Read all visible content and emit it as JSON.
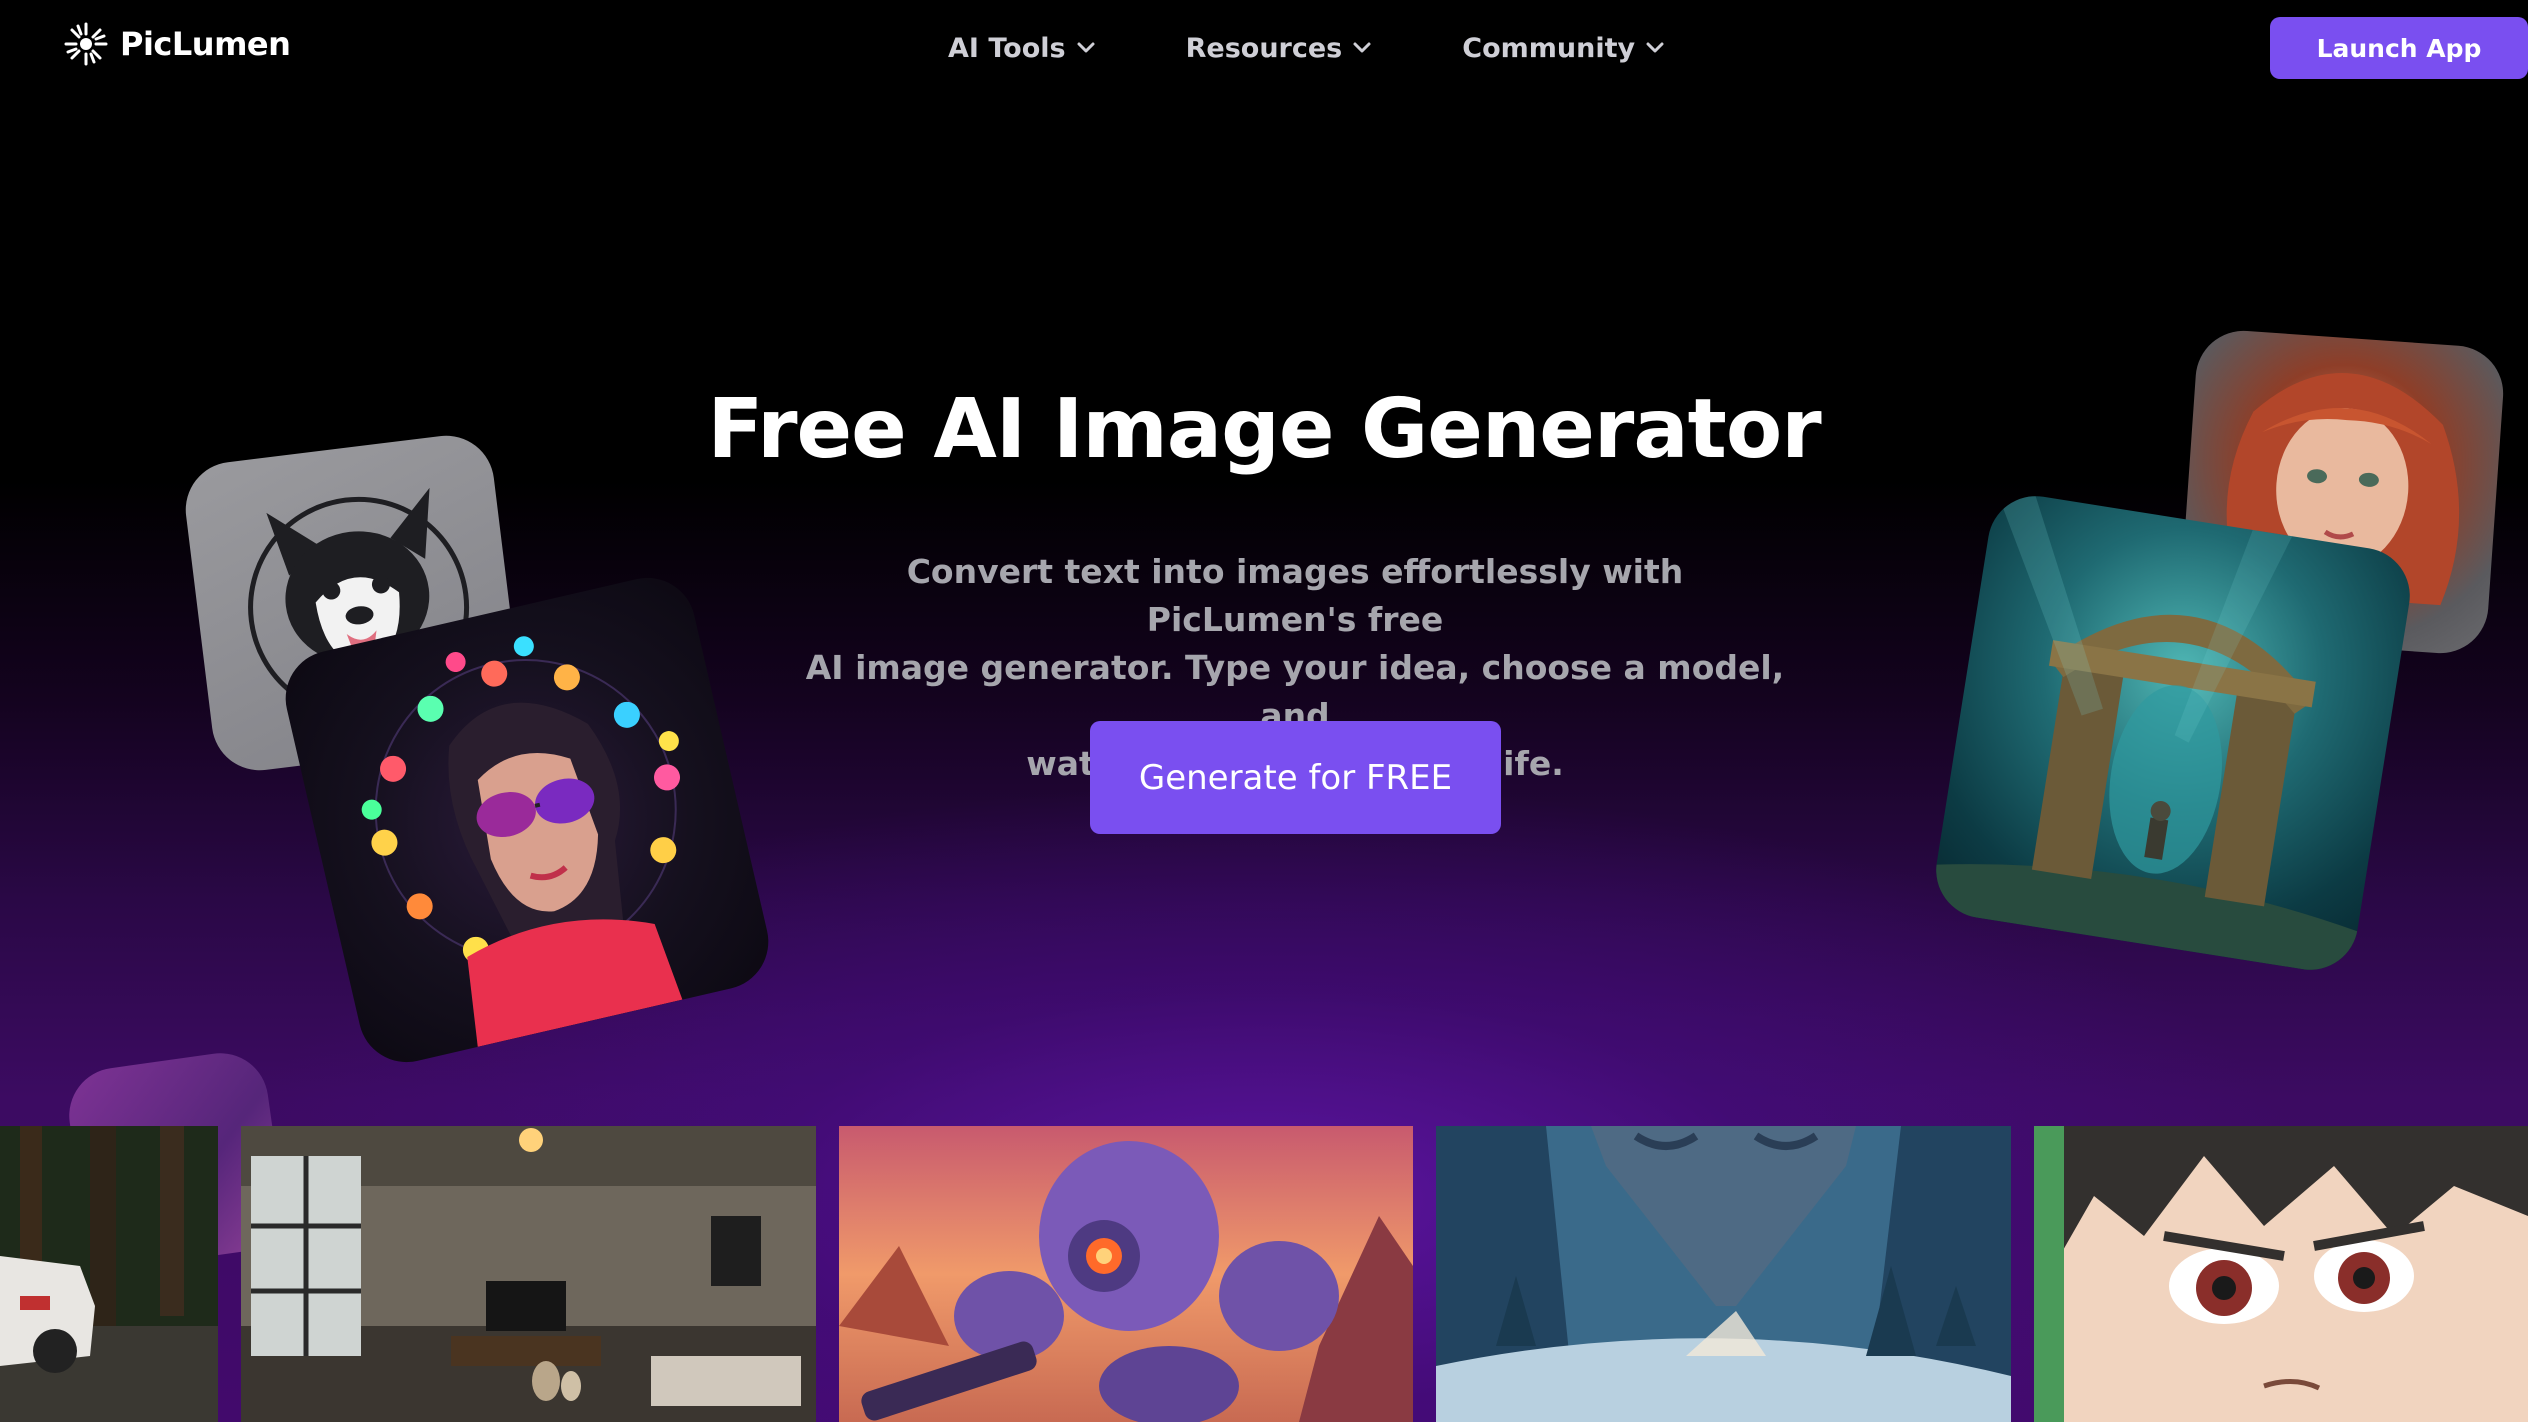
{
  "brand": {
    "name": "PicLumen",
    "logo_icon": "sunburst-logo-icon",
    "accent_color": "#7a4ff0"
  },
  "nav": {
    "items": [
      {
        "label": "AI Tools",
        "icon": "chevron-down-icon"
      },
      {
        "label": "Resources",
        "icon": "chevron-down-icon"
      },
      {
        "label": "Community",
        "icon": "chevron-down-icon"
      }
    ],
    "launch_label": "Launch App"
  },
  "hero": {
    "title": "Free AI Image Generator",
    "subtitle_lines": [
      "Convert text into images effortlessly with PicLumen's free",
      "AI image generator. Type your idea, choose a model, and",
      "watch your text come to life."
    ],
    "cta_label": "Generate for FREE"
  },
  "showcase": {
    "floating_cards": [
      "dog-sticker-image",
      "neon-girl-sunglasses-image",
      "red-hair-girl-image",
      "underwater-arch-image",
      "purple-abstract-image"
    ],
    "gallery": [
      "rally-car-forest-image",
      "loft-living-room-image",
      "purple-robot-image",
      "snowy-forest-monolith-image",
      "anime-boy-image"
    ]
  }
}
